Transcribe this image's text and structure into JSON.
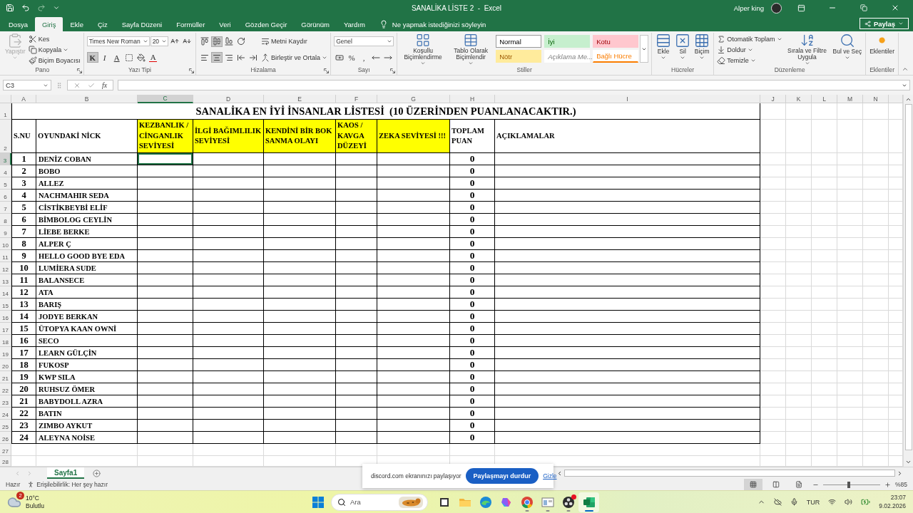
{
  "window": {
    "title": "SANALİKA LİSTE 2  -  Excel",
    "user": "Alper king"
  },
  "ribbon_tabs": [
    {
      "label": "Dosya",
      "selected": false
    },
    {
      "label": "Giriş",
      "selected": true
    },
    {
      "label": "Ekle",
      "selected": false
    },
    {
      "label": "Çiz",
      "selected": false
    },
    {
      "label": "Sayfa Düzeni",
      "selected": false
    },
    {
      "label": "Formüller",
      "selected": false
    },
    {
      "label": "Veri",
      "selected": false
    },
    {
      "label": "Gözden Geçir",
      "selected": false
    },
    {
      "label": "Görünüm",
      "selected": false
    },
    {
      "label": "Yardım",
      "selected": false
    }
  ],
  "tell_me": "Ne yapmak istediğinizi söyleyin",
  "share_button": "Paylaş",
  "ribbon_groups": [
    {
      "label": "Pano",
      "launcher": true,
      "sections": [
        {
          "kind": "big",
          "label": "Yapıştır",
          "disabled": true,
          "menu": true
        },
        {
          "kind": "stack",
          "lines": [
            {
              "controls": [
                {
                  "kind": "small",
                  "label": "Kes",
                  "menu": false
                }
              ]
            },
            {
              "controls": [
                {
                  "kind": "small",
                  "label": "Kopyala",
                  "menu": true
                }
              ]
            },
            {
              "controls": [
                {
                  "kind": "small",
                  "label": "Biçim Boyacısı",
                  "menu": false
                }
              ]
            }
          ]
        }
      ]
    },
    {
      "label": "Yazı Tipi",
      "launcher": true,
      "sections": [
        {
          "kind": "stack",
          "lines": [
            {
              "controls": [
                {
                  "kind": "field",
                  "value": "Times New Roman"
                },
                {
                  "kind": "field",
                  "value": "20"
                },
                {
                  "kind": "tool",
                  "selected": false
                },
                {
                  "kind": "tool",
                  "selected": false
                }
              ]
            },
            {
              "controls": [
                {
                  "kind": "glyph",
                  "label": "K",
                  "selected": true
                },
                {
                  "kind": "glyph",
                  "label": "I",
                  "selected": false
                },
                {
                  "kind": "glyph",
                  "label": "A",
                  "selected": false
                },
                {
                  "kind": "tool",
                  "selected": false
                },
                {
                  "kind": "tool",
                  "selected": false
                },
                {
                  "kind": "glyph",
                  "label": "A",
                  "selected": false
                }
              ]
            }
          ]
        }
      ]
    },
    {
      "label": "Hizalama",
      "launcher": true,
      "sections": [
        {
          "kind": "stack",
          "lines": [
            {
              "controls": [
                {
                  "kind": "tool",
                  "selected": false
                },
                {
                  "kind": "tool",
                  "selected": true
                },
                {
                  "kind": "tool",
                  "selected": false
                },
                {
                  "kind": "tool",
                  "selected": false
                }
              ]
            },
            {
              "controls": [
                {
                  "kind": "tool",
                  "selected": false
                },
                {
                  "kind": "tool",
                  "selected": true
                },
                {
                  "kind": "tool",
                  "selected": false
                },
                {
                  "kind": "tool",
                  "selected": false
                },
                {
                  "kind": "tool",
                  "selected": false
                }
              ]
            }
          ]
        },
        {
          "kind": "stack",
          "lines": [
            {
              "controls": [
                {
                  "kind": "small",
                  "label": "Metni Kaydır",
                  "menu": false
                }
              ]
            },
            {
              "controls": [
                {
                  "kind": "small",
                  "label": "Birleştir ve Ortala",
                  "menu": true
                }
              ]
            }
          ]
        }
      ]
    },
    {
      "label": "Sayı",
      "launcher": true,
      "sections": [
        {
          "kind": "stack",
          "lines": [
            {
              "controls": [
                {
                  "kind": "field",
                  "value": "Genel"
                }
              ]
            },
            {
              "controls": [
                {
                  "kind": "tool",
                  "selected": false
                },
                {
                  "kind": "glyph",
                  "label": "%",
                  "selected": false
                },
                {
                  "kind": "glyph",
                  "label": ",",
                  "selected": false
                },
                {
                  "kind": "tool",
                  "selected": false
                },
                {
                  "kind": "tool",
                  "selected": false
                }
              ]
            }
          ]
        }
      ]
    },
    {
      "label": "Stiller",
      "launcher": false,
      "sections": [
        {
          "kind": "big",
          "label": "Koşullu Biçimlendirme",
          "disabled": false,
          "menu": true
        },
        {
          "kind": "big",
          "label": "Tablo Olarak Biçimlendir",
          "disabled": false,
          "menu": true
        },
        {
          "kind": "styles",
          "items": [
            {
              "label": "Normal",
              "color": "#ffffff"
            },
            {
              "label": "İyi",
              "color": "#c6efce"
            },
            {
              "label": "Kotu",
              "color": "#ffc7ce"
            },
            {
              "label": "Nötr",
              "color": "#ffeb9c"
            },
            {
              "label": "Açıklama Me...",
              "color": "#ffffff"
            },
            {
              "label": "Bağlı Hücre",
              "color": "#ffffff"
            }
          ]
        }
      ]
    },
    {
      "label": "Hücreler",
      "launcher": false,
      "sections": [
        {
          "kind": "big",
          "label": "Ekle",
          "disabled": false,
          "menu": true
        },
        {
          "kind": "big",
          "label": "Sil",
          "disabled": false,
          "menu": true
        },
        {
          "kind": "big",
          "label": "Biçim",
          "disabled": false,
          "menu": true
        }
      ]
    },
    {
      "label": "Düzenleme",
      "launcher": false,
      "sections": [
        {
          "kind": "stack",
          "lines": [
            {
              "controls": [
                {
                  "kind": "small",
                  "label": "Otomatik Toplam",
                  "menu": true
                }
              ]
            },
            {
              "controls": [
                {
                  "kind": "small",
                  "label": "Doldur",
                  "menu": true
                }
              ]
            },
            {
              "controls": [
                {
                  "kind": "small",
                  "label": "Temizle",
                  "menu": true
                }
              ]
            }
          ]
        },
        {
          "kind": "big",
          "label": "Sırala ve Filtre Uygula",
          "disabled": false,
          "menu": true
        },
        {
          "kind": "big",
          "label": "Bul ve Seç",
          "disabled": false,
          "menu": true
        }
      ]
    },
    {
      "label": "Eklentiler",
      "launcher": false,
      "sections": [
        {
          "kind": "big",
          "label": "Eklentiler",
          "disabled": false,
          "menu": false
        }
      ]
    }
  ],
  "formula_bar": {
    "name_box": "C3",
    "function_label": "fx"
  },
  "sheet": {
    "column_headers": [
      {
        "label": "A",
        "selected": false
      },
      {
        "label": "B",
        "selected": false
      },
      {
        "label": "C",
        "selected": true
      },
      {
        "label": "D",
        "selected": false
      },
      {
        "label": "E",
        "selected": false
      },
      {
        "label": "F",
        "selected": false
      },
      {
        "label": "G",
        "selected": false
      },
      {
        "label": "H",
        "selected": false
      },
      {
        "label": "I",
        "selected": false
      },
      {
        "label": "J",
        "selected": false
      },
      {
        "label": "K",
        "selected": false
      },
      {
        "label": "L",
        "selected": false
      },
      {
        "label": "M",
        "selected": false
      },
      {
        "label": "N",
        "selected": false
      }
    ],
    "row_headers": [
      {
        "label": "1",
        "selected": false
      },
      {
        "label": "2",
        "selected": false
      },
      {
        "label": "3",
        "selected": true
      },
      {
        "label": "4",
        "selected": false
      },
      {
        "label": "5",
        "selected": false
      },
      {
        "label": "6",
        "selected": false
      },
      {
        "label": "7",
        "selected": false
      },
      {
        "label": "8",
        "selected": false
      },
      {
        "label": "9",
        "selected": false
      },
      {
        "label": "10",
        "selected": false
      },
      {
        "label": "11",
        "selected": false
      },
      {
        "label": "12",
        "selected": false
      },
      {
        "label": "13",
        "selected": false
      },
      {
        "label": "14",
        "selected": false
      },
      {
        "label": "15",
        "selected": false
      },
      {
        "label": "16",
        "selected": false
      },
      {
        "label": "17",
        "selected": false
      },
      {
        "label": "18",
        "selected": false
      },
      {
        "label": "19",
        "selected": false
      },
      {
        "label": "20",
        "selected": false
      },
      {
        "label": "21",
        "selected": false
      },
      {
        "label": "22",
        "selected": false
      },
      {
        "label": "23",
        "selected": false
      },
      {
        "label": "24",
        "selected": false
      },
      {
        "label": "25",
        "selected": false
      },
      {
        "label": "26",
        "selected": false
      },
      {
        "label": "27",
        "selected": false
      },
      {
        "label": "28",
        "selected": false
      }
    ],
    "title": "SANALİKA EN İYİ İNSANLAR LİSTESİ  (10 ÜZERİNDEN PUANLANACAKTIR.)",
    "headers": [
      {
        "text": "S.NU",
        "highlighted": false
      },
      {
        "text": "OYUNDAKİ NİCK",
        "highlighted": false
      },
      {
        "text": "KEZBANLIK / CİNGANLIK SEVİYESİ",
        "highlighted": true
      },
      {
        "text": "İLGİ BAĞIMLILIK SEVİYESİ",
        "highlighted": true
      },
      {
        "text": "KENDİNİ BİR BOK SANMA OLAYI",
        "highlighted": true
      },
      {
        "text": "KAOS / KAVGA DÜZEYİ",
        "highlighted": true
      },
      {
        "text": "ZEKA SEVİYESİ !!!",
        "highlighted": true
      },
      {
        "text": "TOPLAM PUAN",
        "highlighted": false
      },
      {
        "text": "AÇIKLAMALAR",
        "highlighted": false
      }
    ],
    "rows": [
      {
        "no": "1",
        "nick": "DENİZ COBAN",
        "total": "0"
      },
      {
        "no": "2",
        "nick": "BOBO",
        "total": "0"
      },
      {
        "no": "3",
        "nick": "ALLEZ",
        "total": "0"
      },
      {
        "no": "4",
        "nick": "NACHMAHIR SEDA",
        "total": "0"
      },
      {
        "no": "5",
        "nick": "CİSTİKBEYBİ ELİF",
        "total": "0"
      },
      {
        "no": "6",
        "nick": "BİMBOLOG CEYLİN",
        "total": "0"
      },
      {
        "no": "7",
        "nick": "LİEBE BERKE",
        "total": "0"
      },
      {
        "no": "8",
        "nick": "ALPER Ç",
        "total": "0"
      },
      {
        "no": "9",
        "nick": "HELLO GOOD BYE EDA",
        "total": "0"
      },
      {
        "no": "10",
        "nick": "LUMİERA SUDE",
        "total": "0"
      },
      {
        "no": "11",
        "nick": "BALANSECE",
        "total": "0"
      },
      {
        "no": "12",
        "nick": "ATA",
        "total": "0"
      },
      {
        "no": "13",
        "nick": "BARIŞ",
        "total": "0"
      },
      {
        "no": "14",
        "nick": "JODYE BERKAN",
        "total": "0"
      },
      {
        "no": "15",
        "nick": "ÜTOPYA KAAN OWNİ",
        "total": "0"
      },
      {
        "no": "16",
        "nick": "SECO",
        "total": "0"
      },
      {
        "no": "17",
        "nick": "LEARN GÜLÇİN",
        "total": "0"
      },
      {
        "no": "18",
        "nick": "FUKOSP",
        "total": "0"
      },
      {
        "no": "19",
        "nick": "KWP SILA",
        "total": "0"
      },
      {
        "no": "20",
        "nick": "RUHSUZ ÖMER",
        "total": "0"
      },
      {
        "no": "21",
        "nick": "BABYDOLL AZRA",
        "total": "0"
      },
      {
        "no": "22",
        "nick": "BATIN",
        "total": "0"
      },
      {
        "no": "23",
        "nick": "ZIMBO AYKUT",
        "total": "0"
      },
      {
        "no": "24",
        "nick": "ALEYNA NOİSE",
        "total": "0"
      }
    ]
  },
  "sheet_tabs": [
    {
      "label": "Sayfa1",
      "selected": true
    }
  ],
  "share_notice": {
    "text": "discord.com ekranınızı paylaşıyor",
    "stop_button": "Paylaşmayı durdur",
    "hide_link": "Gizle"
  },
  "status_bar": {
    "ready": "Hazır",
    "accessibility": "Erişilebilirlik: Her şey hazır",
    "views": [
      {
        "selected": true
      },
      {
        "selected": false
      },
      {
        "selected": false
      }
    ],
    "zoom": {
      "label": "%85",
      "level": 0.45
    }
  },
  "taskbar": {
    "weather": {
      "badge": "2",
      "temperature": "10°C",
      "condition": "Bulutlu"
    },
    "search": "Ara",
    "apps": [
      {
        "running": false,
        "active": false,
        "notification": false
      },
      {
        "running": false,
        "active": false,
        "notification": false
      },
      {
        "running": false,
        "active": false,
        "notification": false
      },
      {
        "running": false,
        "active": false,
        "notification": false
      },
      {
        "running": true,
        "active": false,
        "notification": false
      },
      {
        "running": true,
        "active": false,
        "notification": false
      },
      {
        "running": true,
        "active": false,
        "notification": true
      },
      {
        "running": true,
        "active": true,
        "notification": false
      }
    ],
    "language": "TUR",
    "time": "23:07",
    "date": "9.02.2026"
  }
}
